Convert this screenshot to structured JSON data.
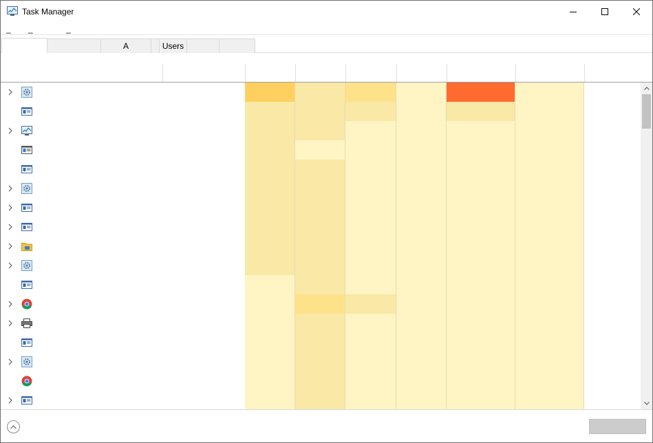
{
  "window": {
    "title": "Task Manager",
    "app_icon": "task-manager-icon"
  },
  "title_buttons": {
    "minimize_icon": "minimize-icon",
    "maximize_icon": "maximize-icon",
    "close_icon": "close-icon"
  },
  "menu": {
    "items": [
      "_",
      "_",
      "_"
    ]
  },
  "tabs": [
    {
      "label": "",
      "active": true
    },
    {
      "label": "",
      "active": false
    },
    {
      "label": "A",
      "active": false
    },
    {
      "label": "",
      "active": false
    },
    {
      "label": "Users",
      "active": false
    },
    {
      "label": "",
      "active": false
    },
    {
      "label": "",
      "active": false
    }
  ],
  "rows": [
    {
      "expandable": true,
      "icon": "gear-icon"
    },
    {
      "expandable": false,
      "icon": "window-icon"
    },
    {
      "expandable": true,
      "icon": "task-manager-icon"
    },
    {
      "expandable": false,
      "icon": "window-alt-icon"
    },
    {
      "expandable": false,
      "icon": "window-icon"
    },
    {
      "expandable": true,
      "icon": "gear-icon"
    },
    {
      "expandable": true,
      "icon": "window-icon"
    },
    {
      "expandable": true,
      "icon": "window-icon"
    },
    {
      "expandable": true,
      "icon": "file-explorer-icon"
    },
    {
      "expandable": true,
      "icon": "gear-icon"
    },
    {
      "expandable": false,
      "icon": "window-icon"
    },
    {
      "expandable": true,
      "icon": "chrome-icon"
    },
    {
      "expandable": true,
      "icon": "printer-icon"
    },
    {
      "expandable": false,
      "icon": "window-icon"
    },
    {
      "expandable": true,
      "icon": "gear-icon"
    },
    {
      "expandable": false,
      "icon": "chrome-icon"
    },
    {
      "expandable": true,
      "icon": "window-icon"
    }
  ],
  "heat_colors": {
    "h0": "#fff4c4",
    "h1": "#f9e8a6",
    "h2": "#fde28a",
    "h3": "#ffd05f",
    "hot": "#ff6a2e"
  },
  "heat_map": [
    [
      "h3",
      "h1",
      "h2",
      "h0",
      "hot",
      "h0"
    ],
    [
      "h1",
      "h1",
      "h1",
      "h0",
      "h1",
      "h0"
    ],
    [
      "h1",
      "h1",
      "h0",
      "h0",
      "h0",
      "h0"
    ],
    [
      "h1",
      "h0",
      "h0",
      "h0",
      "h0",
      "h0"
    ],
    [
      "h1",
      "h1",
      "h0",
      "h0",
      "h0",
      "h0"
    ],
    [
      "h1",
      "h1",
      "h0",
      "h0",
      "h0",
      "h0"
    ],
    [
      "h1",
      "h1",
      "h0",
      "h0",
      "h0",
      "h0"
    ],
    [
      "h1",
      "h1",
      "h0",
      "h0",
      "h0",
      "h0"
    ],
    [
      "h1",
      "h1",
      "h0",
      "h0",
      "h0",
      "h0"
    ],
    [
      "h1",
      "h1",
      "h0",
      "h0",
      "h0",
      "h0"
    ],
    [
      "h0",
      "h1",
      "h0",
      "h0",
      "h0",
      "h0"
    ],
    [
      "h0",
      "h2",
      "h1",
      "h0",
      "h0",
      "h0"
    ],
    [
      "h0",
      "h1",
      "h0",
      "h0",
      "h0",
      "h0"
    ],
    [
      "h0",
      "h1",
      "h0",
      "h0",
      "h0",
      "h0"
    ],
    [
      "h0",
      "h1",
      "h0",
      "h0",
      "h0",
      "h0"
    ],
    [
      "h0",
      "h1",
      "h0",
      "h0",
      "h0",
      "h0"
    ],
    [
      "h0",
      "h1",
      "h0",
      "h0",
      "h0",
      "h0"
    ]
  ],
  "footer": {
    "fewer_details_icon": "chevron-up-circle-icon",
    "end_task_label": ""
  }
}
